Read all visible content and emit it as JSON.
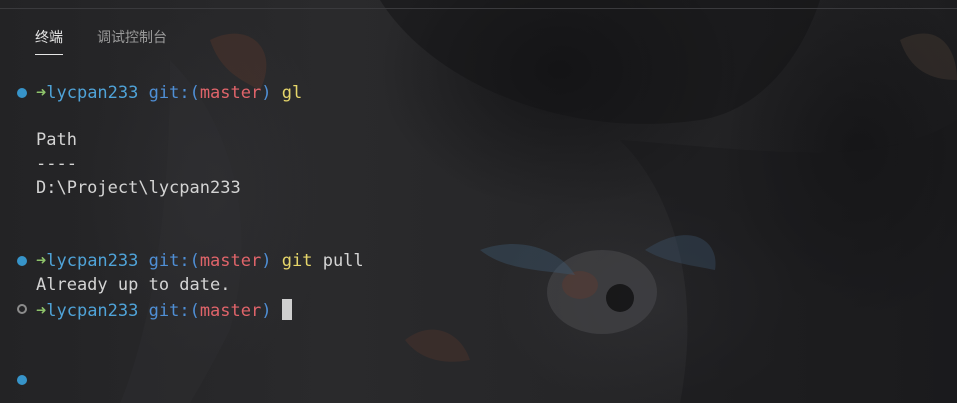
{
  "tabs": [
    {
      "label": "终端",
      "active": true
    },
    {
      "label": "调试控制台",
      "active": false
    }
  ],
  "prompt": {
    "arrow": "➜",
    "dir": "lycpan233",
    "git_label": "git:(",
    "branch": "master",
    "git_close": ")"
  },
  "lines": {
    "cmd1": "gl",
    "out1_a": "Path",
    "out1_b": "----",
    "out1_c": "D:\\Project\\lycpan233",
    "cmd2_a": "git",
    "cmd2_b": "pull",
    "out2": "Already up to date."
  },
  "colors": {
    "accent_dot": "#3794c9",
    "arrow": "#8ec36a",
    "dir": "#4fa3d8",
    "branch": "#e0646a",
    "command": "#e6d66a"
  }
}
